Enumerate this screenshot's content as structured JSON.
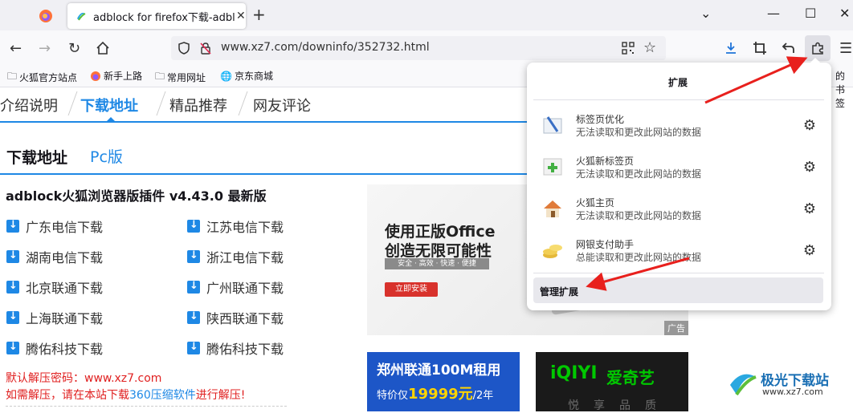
{
  "tab": {
    "title": "adblock for firefox下载-adblo",
    "close": "✕"
  },
  "window": {
    "minimize": "—",
    "maximize": "☐",
    "close": "✕",
    "dropdown": "⌄"
  },
  "nav": {
    "url": "www.xz7.com/downinfo/352732.html"
  },
  "bookmarks": [
    {
      "label": "火狐官方站点",
      "icon": "folder-icon"
    },
    {
      "label": "新手上路",
      "icon": "firefox-icon"
    },
    {
      "label": "常用网址",
      "icon": "folder-icon"
    },
    {
      "label": "京东商城",
      "icon": "globe-icon"
    }
  ],
  "bookmarks_right": "的书签",
  "page": {
    "tabs": [
      "介绍说明",
      "下载地址",
      "精品推荐",
      "网友评论"
    ],
    "active_tab_index": 1,
    "section_title": "下载地址",
    "section_sub": "Pc版",
    "product_title": "adblock火狐浏览器版插件 v4.43.0 最新版",
    "downloads_left": [
      "广东电信下载",
      "湖南电信下载",
      "北京联通下载",
      "上海联通下载",
      "腾佑科技下载"
    ],
    "downloads_right": [
      "江苏电信下载",
      "浙江电信下载",
      "广州联通下载",
      "陕西联通下载",
      "腾佑科技下载"
    ],
    "password_line": "默认解压密码：www.xz7.com",
    "unzip_line_a": "如需解压，请在本站下载",
    "unzip_line_link": "360压缩软件",
    "unzip_line_b": "进行解压!"
  },
  "ads": {
    "office_line1": "使用正版Office",
    "office_line2": "创造无限可能性",
    "office_pill": "安全 · 高效 · 快速 · 便捷",
    "office_button": "立即安装",
    "ad_tag": "广告",
    "unicom_line1": "郑州联通100M租用",
    "unicom_price_prefix": "特价仅",
    "unicom_price": "19999元",
    "unicom_price_suffix": "/2年",
    "iqiyi_logo": "iQIYI",
    "iqiyi_name": "爱奇艺",
    "iqiyi_sub": "悦享品质"
  },
  "extensions_panel": {
    "title": "扩展",
    "items": [
      {
        "name": "标签页优化",
        "desc": "无法读取和更改此网站的数据",
        "icon": "brush-icon"
      },
      {
        "name": "火狐新标签页",
        "desc": "无法读取和更改此网站的数据",
        "icon": "new-tab-icon"
      },
      {
        "name": "火狐主页",
        "desc": "无法读取和更改此网站的数据",
        "icon": "home-icon"
      },
      {
        "name": "网银支付助手",
        "desc": "总能读取和更改此网站的数据",
        "icon": "coins-icon"
      }
    ],
    "manage_label": "管理扩展"
  },
  "watermark": {
    "name": "极光下载站",
    "url": "www.xz7.com"
  }
}
